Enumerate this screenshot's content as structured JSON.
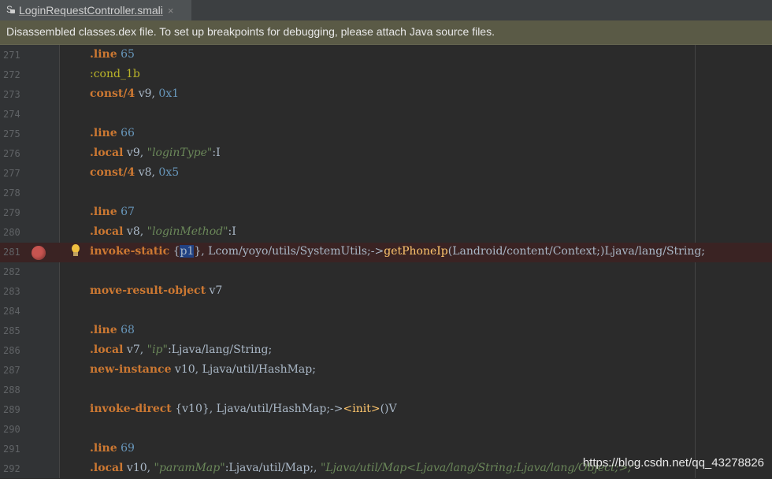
{
  "tab": {
    "icon_letter": "S",
    "filename": "LoginRequestController.smali",
    "close": "×"
  },
  "banner": {
    "text": "Disassembled classes.dex file. To set up breakpoints for debugging, please attach Java source files."
  },
  "lines": [
    {
      "num": "271",
      "tokens": [
        [
          "k",
          ".line"
        ],
        [
          "t",
          " "
        ],
        [
          "n",
          "65"
        ]
      ]
    },
    {
      "num": "272",
      "tokens": [
        [
          "lb",
          ":cond_1b"
        ]
      ]
    },
    {
      "num": "273",
      "tokens": [
        [
          "k",
          "const/4"
        ],
        [
          "t",
          " v9, "
        ],
        [
          "n",
          "0x1"
        ]
      ]
    },
    {
      "num": "274",
      "tokens": []
    },
    {
      "num": "275",
      "tokens": [
        [
          "k",
          ".line"
        ],
        [
          "t",
          " "
        ],
        [
          "n",
          "66"
        ]
      ]
    },
    {
      "num": "276",
      "tokens": [
        [
          "k",
          ".local"
        ],
        [
          "t",
          " v9, "
        ],
        [
          "s",
          "\"loginType\""
        ],
        [
          "t",
          ":I"
        ]
      ]
    },
    {
      "num": "277",
      "tokens": [
        [
          "k",
          "const/4"
        ],
        [
          "t",
          " v8, "
        ],
        [
          "n",
          "0x5"
        ]
      ]
    },
    {
      "num": "278",
      "tokens": []
    },
    {
      "num": "279",
      "tokens": [
        [
          "k",
          ".line"
        ],
        [
          "t",
          " "
        ],
        [
          "n",
          "67"
        ]
      ]
    },
    {
      "num": "280",
      "tokens": [
        [
          "k",
          ".local"
        ],
        [
          "t",
          " v8, "
        ],
        [
          "s",
          "\"loginMethod\""
        ],
        [
          "t",
          ":I"
        ]
      ]
    },
    {
      "num": "281",
      "highlight": true,
      "breakpoint": true,
      "bulb": true,
      "tokens": [
        [
          "k",
          "invoke-static"
        ],
        [
          "t",
          " {"
        ],
        [
          "sel",
          "p1"
        ],
        [
          "t",
          "}, Lcom/yoyo/utils/SystemUtils;->"
        ],
        [
          "f",
          "getPhoneIp"
        ],
        [
          "t",
          "(Landroid/content/Context;)Ljava/lang/String;"
        ]
      ]
    },
    {
      "num": "282",
      "tokens": []
    },
    {
      "num": "283",
      "tokens": [
        [
          "k",
          "move-result-object"
        ],
        [
          "t",
          " v7"
        ]
      ]
    },
    {
      "num": "284",
      "tokens": []
    },
    {
      "num": "285",
      "tokens": [
        [
          "k",
          ".line"
        ],
        [
          "t",
          " "
        ],
        [
          "n",
          "68"
        ]
      ]
    },
    {
      "num": "286",
      "tokens": [
        [
          "k",
          ".local"
        ],
        [
          "t",
          " v7, "
        ],
        [
          "s",
          "\"ip\""
        ],
        [
          "t",
          ":Ljava/lang/String;"
        ]
      ]
    },
    {
      "num": "287",
      "tokens": [
        [
          "k",
          "new-instance"
        ],
        [
          "t",
          " v10, Ljava/util/HashMap;"
        ]
      ]
    },
    {
      "num": "288",
      "tokens": []
    },
    {
      "num": "289",
      "tokens": [
        [
          "k",
          "invoke-direct"
        ],
        [
          "t",
          " {v10}, Ljava/util/HashMap;->"
        ],
        [
          "f",
          "<init>"
        ],
        [
          "t",
          "()V"
        ]
      ]
    },
    {
      "num": "290",
      "tokens": []
    },
    {
      "num": "291",
      "tokens": [
        [
          "k",
          ".line"
        ],
        [
          "t",
          " "
        ],
        [
          "n",
          "69"
        ]
      ]
    },
    {
      "num": "292",
      "tokens": [
        [
          "k",
          ".local"
        ],
        [
          "t",
          " v10, "
        ],
        [
          "s",
          "\"paramMap\""
        ],
        [
          "t",
          ":Ljava/util/Map;, "
        ],
        [
          "s",
          "\"Ljava/util/Map<Ljava/lang/String;Ljava/lang/Object;>;\""
        ]
      ]
    }
  ],
  "watermark": "https://blog.csdn.net/qq_43278826"
}
